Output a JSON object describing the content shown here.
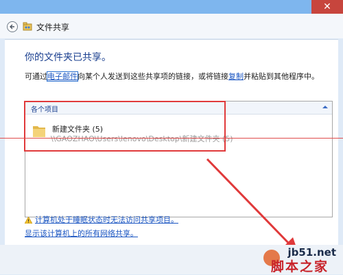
{
  "window": {
    "close_glyph": "✕",
    "title": "文件共享"
  },
  "content": {
    "heading": "你的文件夹已共享。",
    "desc_pre": "可通过",
    "email_link": "电子邮件",
    "desc_mid": "向某个人发送到这些共享项的链接，或将链接",
    "copy_link": "复制",
    "desc_post": "并粘贴到其他程序中。"
  },
  "panel": {
    "header": "各个项目",
    "items": [
      {
        "name": "新建文件夹 (5)",
        "path": "\\\\GAOZHAO\\Users\\lenovo\\Desktop\\新建文件夹 (5)"
      }
    ]
  },
  "footer": {
    "sleep_warning": "计算机处于睡眠状态时无法访问共享项目。",
    "network_shares_link": "显示该计算机上的所有网络共享。"
  },
  "watermark": {
    "url": "jb51.net",
    "site": "脚本之家"
  },
  "colors": {
    "accent": "#1a55c2",
    "annotation": "#e0393a",
    "title_bar": "#7eb6ee"
  },
  "icons": [
    "back-arrow-icon",
    "share-icon",
    "collapse-icon",
    "folder-icon",
    "warning-icon"
  ]
}
